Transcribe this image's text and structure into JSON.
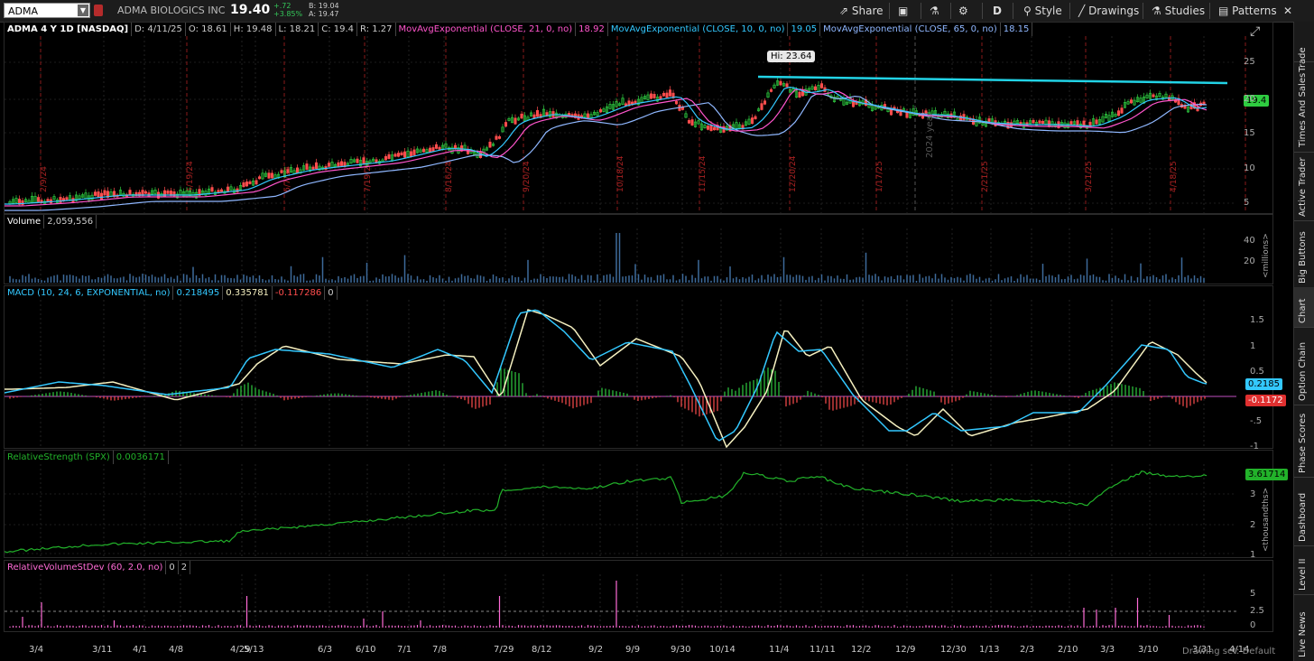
{
  "toolbar": {
    "symbol": "ADMA",
    "company": "ADMA BIOLOGICS INC",
    "last": "19.40",
    "change": "+.72",
    "change_pct": "+3.85%",
    "bid": "B: 19.04",
    "ask": "A: 19.47",
    "buttons": {
      "share": "Share",
      "period": "D",
      "style": "Style",
      "drawings": "Drawings",
      "studies": "Studies",
      "patterns": "Patterns"
    }
  },
  "price_pane": {
    "title": "ADMA 4 Y 1D [NASDAQ]",
    "date": "D: 4/11/25",
    "open": "O: 18.61",
    "high": "H: 19.48",
    "low": "L: 18.21",
    "close": "C: 19.4",
    "range": "R: 1.27",
    "ma1_label": "MovAvgExponential (CLOSE, 21, 0, no)",
    "ma1_value": "18.92",
    "ma2_label": "MovAvgExponential (CLOSE, 10, 0, no)",
    "ma2_value": "19.05",
    "ma3_label": "MovAvgExponential (CLOSE, 65, 0, no)",
    "ma3_value": "18.15",
    "hi_label": "Hi: 23.64",
    "last_tag": "19.4",
    "year_label": "2024 year",
    "y_ticks": [
      "25",
      "20",
      "15",
      "10",
      "5"
    ],
    "red_dates": [
      "2/9/24",
      "4/19/24",
      "6/7/24",
      "7/19/24",
      "8/16/24",
      "9/20/24",
      "10/18/24",
      "11/15/24",
      "12/20/24",
      "1/17/25",
      "2/21/25",
      "3/21/25",
      "4/18/25"
    ]
  },
  "volume_pane": {
    "title": "Volume",
    "value": "2,059,556",
    "y_ticks": [
      "40",
      "20"
    ],
    "unit": "<millions>"
  },
  "macd_pane": {
    "title": "MACD (10, 24, 6, EXPONENTIAL, no)",
    "v1": "0.218495",
    "v2": "0.335781",
    "v3": "-0.117286",
    "v4": "0",
    "y_ticks": [
      "1.5",
      "1",
      "0.5",
      "-.5",
      "-1"
    ],
    "tag1": "0.2185",
    "tag2": "-0.1172"
  },
  "rs_pane": {
    "title": "RelativeStrength (SPX)",
    "value": "0.0036171",
    "y_ticks": [
      "3",
      "2",
      "1"
    ],
    "unit": "<thousandths>",
    "tag": "3.61714"
  },
  "rv_pane": {
    "title": "RelativeVolumeStDev (60, 2.0, no)",
    "v1": "0",
    "v2": "2",
    "y_ticks": [
      "5",
      "2.5",
      "0"
    ]
  },
  "x_dates": [
    "3/4",
    "3/11",
    "4/1",
    "4/8",
    "4/29",
    "5/13",
    "6/3",
    "6/10",
    "7/1",
    "7/8",
    "7/29",
    "8/12",
    "9/2",
    "9/9",
    "9/30",
    "10/14",
    "11/4",
    "11/11",
    "12/2",
    "12/9",
    "12/30",
    "1/13",
    "2/3",
    "2/10",
    "3/3",
    "3/10",
    "3/31",
    "4/14"
  ],
  "drawing_set": "Drawing set: Default",
  "right_tabs": [
    "Trade",
    "Times And Sales",
    "Active Trader",
    "Big Buttons",
    "Chart",
    "Option Chain",
    "Phase Scores",
    "Dashboard",
    "Level II",
    "Live News"
  ],
  "colors": {
    "up": "#2ecc40",
    "down": "#ff4d4d",
    "ema10": "#33c8ff",
    "ema21": "#ff55cc",
    "ema65": "#8fb7ff",
    "trendline": "#22d3e6",
    "macd": "#33c8ff",
    "signal": "#f5f0c0",
    "rs": "#22b22a",
    "rv": "#ff6bd6"
  }
}
